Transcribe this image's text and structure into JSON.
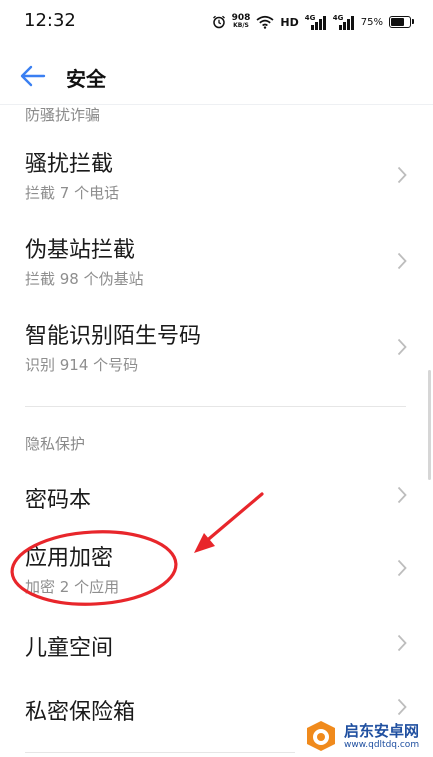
{
  "status_bar": {
    "time": "12:32",
    "net_speed_value": "908",
    "net_speed_unit": "KB/S",
    "hd": "HD",
    "sim1": "4G",
    "sim2": "4G",
    "battery_text": "75%",
    "battery_level": 0.75
  },
  "header": {
    "title": "安全",
    "accent_color": "#3a7ff2"
  },
  "sections": [
    {
      "title": "防骚扰诈骗",
      "items": [
        {
          "label": "骚扰拦截",
          "sub": "拦截 7 个电话"
        },
        {
          "label": "伪基站拦截",
          "sub": "拦截 98 个伪基站"
        },
        {
          "label": "智能识别陌生号码",
          "sub": "识别 914 个号码"
        }
      ]
    },
    {
      "title": "隐私保护",
      "items": [
        {
          "label": "密码本"
        },
        {
          "label": "应用加密",
          "sub": "加密 2 个应用"
        },
        {
          "label": "儿童空间"
        },
        {
          "label": "私密保险箱"
        }
      ]
    }
  ],
  "annotation": {
    "color": "#e8262b"
  },
  "watermark": {
    "title": "启东安卓网",
    "url": "www.qdltdq.com",
    "color": "#1f4fa0"
  },
  "icons": {
    "back": "back-arrow-icon",
    "chevron": "chevron-right-icon",
    "alarm": "alarm-icon",
    "wifi": "wifi-icon",
    "signal": "signal-icon",
    "battery": "battery-icon"
  }
}
